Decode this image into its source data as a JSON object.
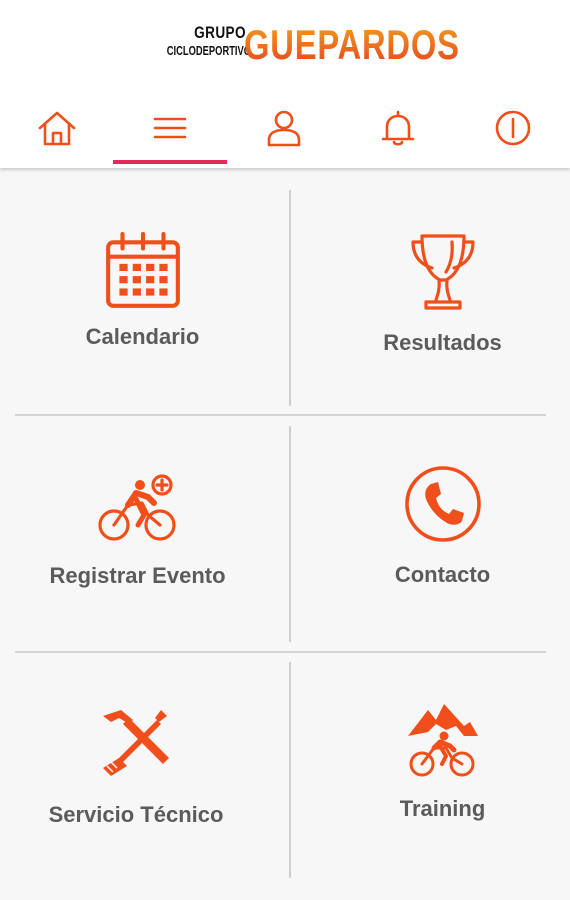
{
  "logo": {
    "line1": "GRUPO",
    "line2": "CICLODEPORTIVO",
    "brand": "GUEPARDOS"
  },
  "nav": {
    "items": [
      {
        "icon": "home-icon"
      },
      {
        "icon": "menu-icon",
        "selected": true
      },
      {
        "icon": "user-icon"
      },
      {
        "icon": "bell-icon"
      },
      {
        "icon": "info-icon"
      }
    ]
  },
  "menu": {
    "items": [
      {
        "label": "Calendario",
        "icon": "calendar-icon"
      },
      {
        "label": "Resultados",
        "icon": "trophy-icon"
      },
      {
        "label": "Registrar Evento",
        "icon": "cyclist-add-icon"
      },
      {
        "label": "Contacto",
        "icon": "phone-icon"
      },
      {
        "label": "Servicio Técnico",
        "icon": "tools-icon"
      },
      {
        "label": "Training",
        "icon": "mountain-cyclist-icon"
      }
    ]
  },
  "colors": {
    "accent": "#f04e1a",
    "indicator": "#e8275a",
    "label": "#5b5b5b",
    "background": "#f7f7f7"
  }
}
